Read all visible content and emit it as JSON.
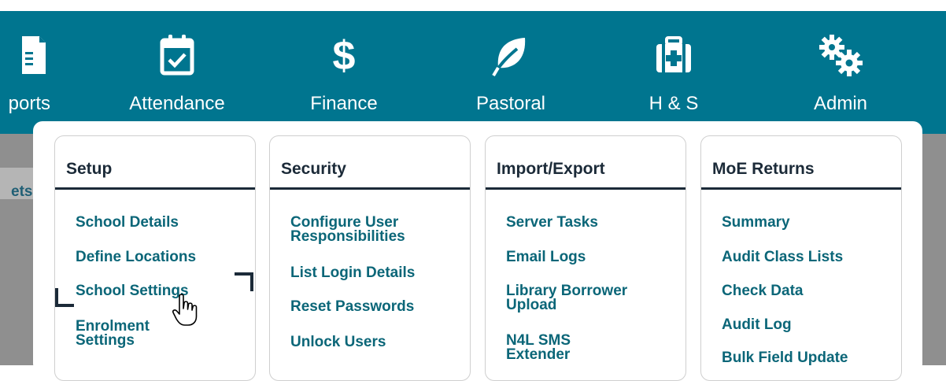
{
  "nav": {
    "items": [
      {
        "label": "ports",
        "icon": "reports-icon"
      },
      {
        "label": "Attendance",
        "icon": "calendar-check-icon"
      },
      {
        "label": "Finance",
        "icon": "dollar-icon"
      },
      {
        "label": "Pastoral",
        "icon": "leaf-icon"
      },
      {
        "label": "H & S",
        "icon": "first-aid-icon"
      },
      {
        "label": "Admin",
        "icon": "gears-icon"
      }
    ]
  },
  "background": {
    "partial_label": "ets"
  },
  "menu": {
    "columns": [
      {
        "title": "Setup",
        "links": [
          "School Details",
          "Define Locations",
          "School Settings",
          "Enrolment Settings"
        ]
      },
      {
        "title": "Security",
        "links": [
          "Configure User Responsibilities",
          "List Login Details",
          "Reset Passwords",
          "Unlock Users"
        ]
      },
      {
        "title": "Import/Export",
        "links": [
          "Server Tasks",
          "Email Logs",
          "Library Borrower Upload",
          "N4L SMS Extender"
        ]
      },
      {
        "title": "MoE Returns",
        "links": [
          "Summary",
          "Audit Class Lists",
          "Check Data",
          "Audit Log",
          "Bulk Field Update"
        ]
      }
    ],
    "highlighted": "School Settings"
  },
  "colors": {
    "topbar": "#00758f",
    "link": "#0b6678",
    "heading": "#1b2a38",
    "highlight": "#c9dde1"
  }
}
